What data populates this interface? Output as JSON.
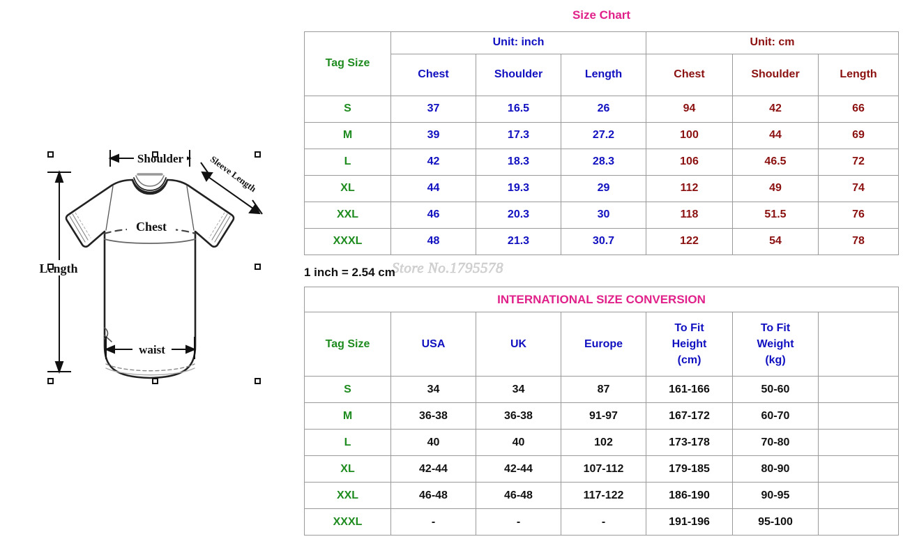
{
  "diagram": {
    "labels": {
      "shoulder": "Shoulder",
      "sleeve_length": "Sleeve Length",
      "chest": "Chest",
      "length": "Length",
      "waist": "waist"
    }
  },
  "watermark": "Store No.1795578",
  "inch_note": "1 inch = 2.54 cm",
  "colors": {
    "title_pink": "#e0218a",
    "tag_green": "#1e8b1e",
    "inch_blue": "#1010c0",
    "cm_dark_red": "#8b1010",
    "black": "#111111",
    "border": "#9a9a9a"
  },
  "size_chart": {
    "title": "Size Chart",
    "tag_size_header": "Tag Size",
    "unit_groups": [
      {
        "label": "Unit: inch",
        "columns": [
          "Chest",
          "Shoulder",
          "Length"
        ]
      },
      {
        "label": "Unit: cm",
        "columns": [
          "Chest",
          "Shoulder",
          "Length"
        ]
      }
    ],
    "rows": [
      {
        "tag": "S",
        "inch": [
          "37",
          "16.5",
          "26"
        ],
        "cm": [
          "94",
          "42",
          "66"
        ]
      },
      {
        "tag": "M",
        "inch": [
          "39",
          "17.3",
          "27.2"
        ],
        "cm": [
          "100",
          "44",
          "69"
        ]
      },
      {
        "tag": "L",
        "inch": [
          "42",
          "18.3",
          "28.3"
        ],
        "cm": [
          "106",
          "46.5",
          "72"
        ]
      },
      {
        "tag": "XL",
        "inch": [
          "44",
          "19.3",
          "29"
        ],
        "cm": [
          "112",
          "49",
          "74"
        ]
      },
      {
        "tag": "XXL",
        "inch": [
          "46",
          "20.3",
          "30"
        ],
        "cm": [
          "118",
          "51.5",
          "76"
        ]
      },
      {
        "tag": "XXXL",
        "inch": [
          "48",
          "21.3",
          "30.7"
        ],
        "cm": [
          "122",
          "54",
          "78"
        ]
      }
    ]
  },
  "conversion_chart": {
    "title": "INTERNATIONAL SIZE CONVERSION",
    "headers": [
      "Tag Size",
      "USA",
      "UK",
      "Europe",
      "To Fit Height (cm)",
      "To Fit Weight (kg)",
      ""
    ],
    "header_lines": {
      "tag_size": "Tag Size",
      "usa": "USA",
      "uk": "UK",
      "europe": "Europe",
      "height_l1": "To Fit",
      "height_l2": "Height",
      "height_l3": "(cm)",
      "weight_l1": "To Fit",
      "weight_l2": "Weight",
      "weight_l3": "(kg)"
    },
    "rows": [
      {
        "tag": "S",
        "usa": "34",
        "uk": "34",
        "europe": "87",
        "height": "161-166",
        "weight": "50-60",
        "extra": ""
      },
      {
        "tag": "M",
        "usa": "36-38",
        "uk": "36-38",
        "europe": "91-97",
        "height": "167-172",
        "weight": "60-70",
        "extra": ""
      },
      {
        "tag": "L",
        "usa": "40",
        "uk": "40",
        "europe": "102",
        "height": "173-178",
        "weight": "70-80",
        "extra": ""
      },
      {
        "tag": "XL",
        "usa": "42-44",
        "uk": "42-44",
        "europe": "107-112",
        "height": "179-185",
        "weight": "80-90",
        "extra": ""
      },
      {
        "tag": "XXL",
        "usa": "46-48",
        "uk": "46-48",
        "europe": "117-122",
        "height": "186-190",
        "weight": "90-95",
        "extra": ""
      },
      {
        "tag": "XXXL",
        "usa": "-",
        "uk": "-",
        "europe": "-",
        "height": "191-196",
        "weight": "95-100",
        "extra": ""
      }
    ]
  }
}
